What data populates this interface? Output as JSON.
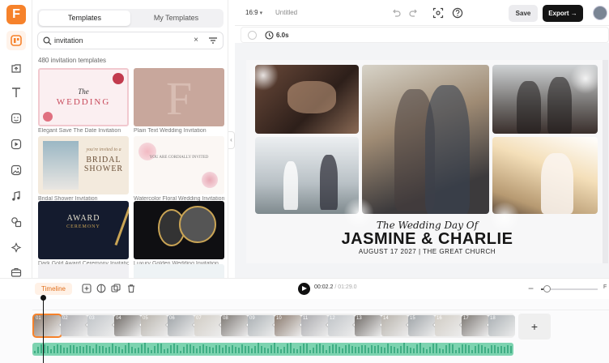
{
  "app": {
    "logo_letter": "F"
  },
  "panel": {
    "tabs": [
      {
        "label": "Templates",
        "active": true
      },
      {
        "label": "My Templates",
        "active": false
      }
    ],
    "search_value": "invitation",
    "clear_symbol": "×",
    "result_count": "480 invitation templates",
    "templates": [
      {
        "caption": "Elegant Save The Date Invitation",
        "thumb_text": "The",
        "thumb_text2": "WEDDING"
      },
      {
        "caption": "Plain Text Wedding Invitation",
        "thumb_text": "F",
        "thumb_text2": ""
      },
      {
        "caption": "Bridal Shower Invitation",
        "thumb_text": "you're invited to a",
        "thumb_text2": "BRIDAL SHOWER"
      },
      {
        "caption": "Watercolor Floral Wedding Invitation",
        "thumb_text": "YOU ARE CORDIALLY INVITED",
        "thumb_text2": ""
      },
      {
        "caption": "Dark Gold Award Ceremony Invitation",
        "thumb_text": "AWARD",
        "thumb_text2": "CEREMONY"
      },
      {
        "caption": "Luxury Golden Wedding Invitation",
        "thumb_text": "",
        "thumb_text2": ""
      }
    ]
  },
  "topbar": {
    "aspect_ratio": "16:9",
    "doc_title": "Untitled",
    "save_label": "Save",
    "export_label": "Export"
  },
  "scene": {
    "duration": "6.0s"
  },
  "canvas": {
    "script_title": "The Wedding Day Of",
    "names": "JASMINE & CHARLIE",
    "date_line": "AUGUST 17 2027  |  THE GREAT CHURCH"
  },
  "timeline": {
    "label": "Timeline",
    "current_time": "00:02.2",
    "total_time": "01:29.0",
    "fit_label": "F",
    "zoom_level": 0.04,
    "clip_numbers": [
      "01",
      "02",
      "03",
      "04",
      "05",
      "06",
      "07",
      "08",
      "09",
      "10",
      "11",
      "12",
      "13",
      "14",
      "15",
      "16",
      "17",
      "18"
    ],
    "add_label": "+"
  },
  "colors": {
    "accent": "#f6822b",
    "export_bg": "#141414",
    "audio": "#7dd3b0"
  }
}
